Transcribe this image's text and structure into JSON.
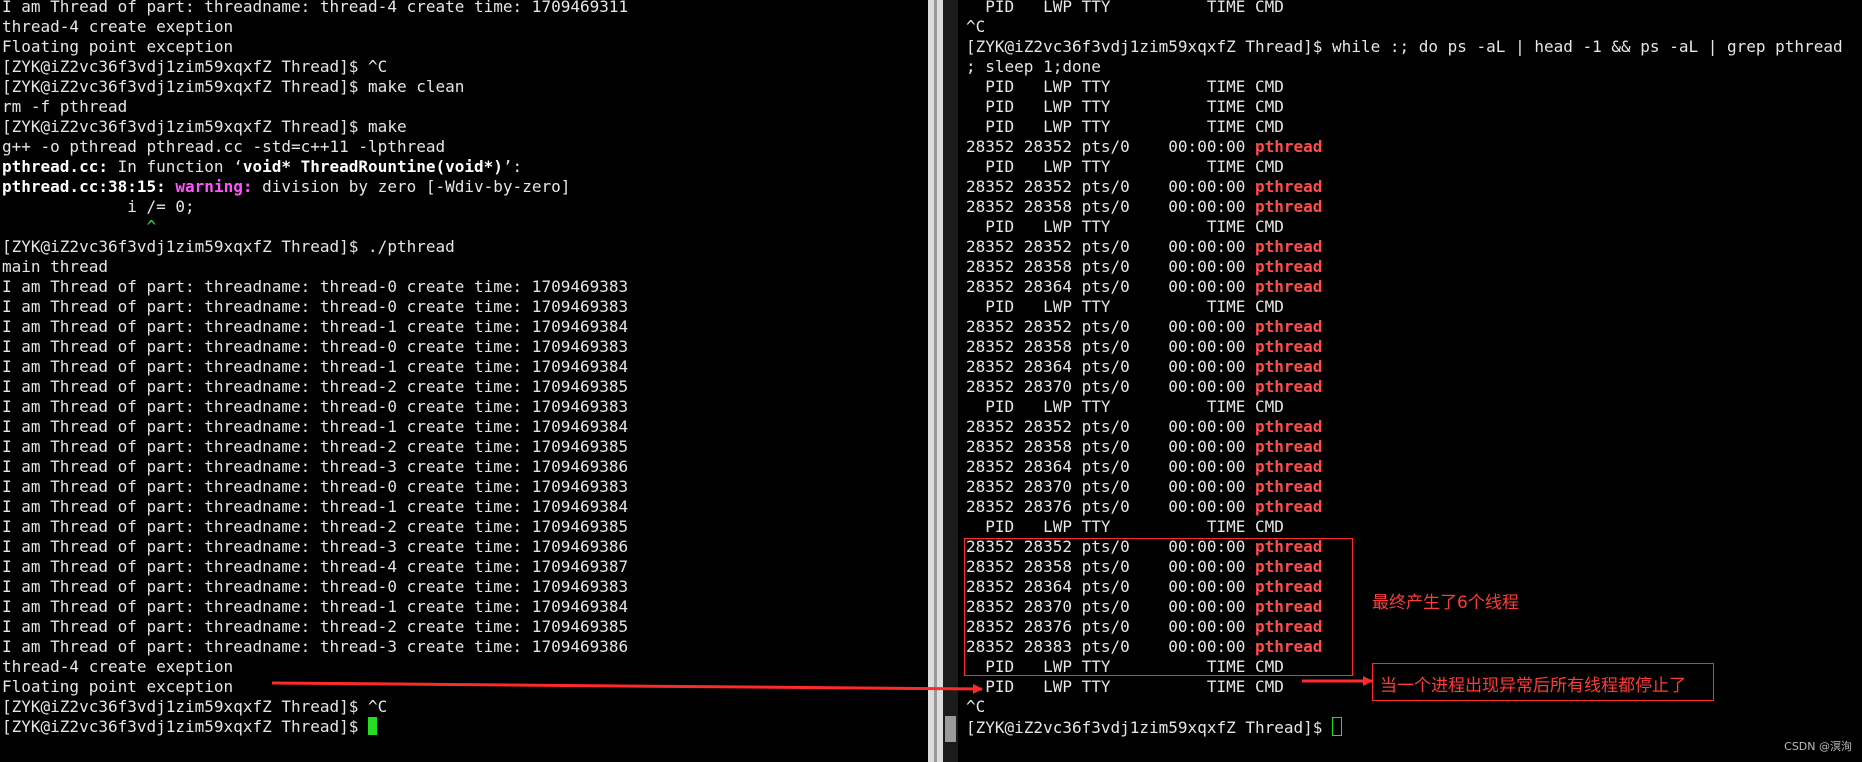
{
  "left_terminal": {
    "lines": [
      [
        {
          "t": "I am Thread of part: threadname: thread-4 create time: 1709469311"
        }
      ],
      [
        {
          "t": "thread-4 create exeption"
        }
      ],
      [
        {
          "t": "Floating point exception"
        }
      ],
      [
        {
          "t": "[ZYK@iZ2vc36f3vdj1zim59xqxfZ Thread]$ ^C"
        }
      ],
      [
        {
          "t": "[ZYK@iZ2vc36f3vdj1zim59xqxfZ Thread]$ make clean"
        }
      ],
      [
        {
          "t": "rm -f pthread"
        }
      ],
      [
        {
          "t": "[ZYK@iZ2vc36f3vdj1zim59xqxfZ Thread]$ make"
        }
      ],
      [
        {
          "t": "g++ -o pthread pthread.cc -std=c++11 -lpthread"
        }
      ],
      [
        {
          "t": "pthread.cc:",
          "s": "b"
        },
        {
          "t": " In function ‘"
        },
        {
          "t": "void* ThreadRountine(void*)",
          "s": "b"
        },
        {
          "t": "’:"
        }
      ],
      [
        {
          "t": "pthread.cc:38:15:",
          "s": "b"
        },
        {
          "t": " "
        },
        {
          "t": "warning:",
          "s": "m"
        },
        {
          "t": " division by zero [-Wdiv-by-zero]"
        }
      ],
      [
        {
          "t": "             i /= 0;"
        }
      ],
      [
        {
          "t": "               ^",
          "s": "g"
        }
      ],
      [
        {
          "t": "[ZYK@iZ2vc36f3vdj1zim59xqxfZ Thread]$ ./pthread"
        }
      ],
      [
        {
          "t": "main thread"
        }
      ],
      [
        {
          "t": "I am Thread of part: threadname: thread-0 create time: 1709469383"
        }
      ],
      [
        {
          "t": "I am Thread of part: threadname: thread-0 create time: 1709469383"
        }
      ],
      [
        {
          "t": "I am Thread of part: threadname: thread-1 create time: 1709469384"
        }
      ],
      [
        {
          "t": "I am Thread of part: threadname: thread-0 create time: 1709469383"
        }
      ],
      [
        {
          "t": "I am Thread of part: threadname: thread-1 create time: 1709469384"
        }
      ],
      [
        {
          "t": "I am Thread of part: threadname: thread-2 create time: 1709469385"
        }
      ],
      [
        {
          "t": "I am Thread of part: threadname: thread-0 create time: 1709469383"
        }
      ],
      [
        {
          "t": "I am Thread of part: threadname: thread-1 create time: 1709469384"
        }
      ],
      [
        {
          "t": "I am Thread of part: threadname: thread-2 create time: 1709469385"
        }
      ],
      [
        {
          "t": "I am Thread of part: threadname: thread-3 create time: 1709469386"
        }
      ],
      [
        {
          "t": "I am Thread of part: threadname: thread-0 create time: 1709469383"
        }
      ],
      [
        {
          "t": "I am Thread of part: threadname: thread-1 create time: 1709469384"
        }
      ],
      [
        {
          "t": "I am Thread of part: threadname: thread-2 create time: 1709469385"
        }
      ],
      [
        {
          "t": "I am Thread of part: threadname: thread-3 create time: 1709469386"
        }
      ],
      [
        {
          "t": "I am Thread of part: threadname: thread-4 create time: 1709469387"
        }
      ],
      [
        {
          "t": "I am Thread of part: threadname: thread-0 create time: 1709469383"
        }
      ],
      [
        {
          "t": "I am Thread of part: threadname: thread-1 create time: 1709469384"
        }
      ],
      [
        {
          "t": "I am Thread of part: threadname: thread-2 create time: 1709469385"
        }
      ],
      [
        {
          "t": "I am Thread of part: threadname: thread-3 create time: 1709469386"
        }
      ],
      [
        {
          "t": "thread-4 create exeption"
        }
      ],
      [
        {
          "t": "Floating point exception"
        }
      ],
      [
        {
          "t": "[ZYK@iZ2vc36f3vdj1zim59xqxfZ Thread]$ ^C"
        }
      ],
      [
        {
          "t": "[ZYK@iZ2vc36f3vdj1zim59xqxfZ Thread]$ "
        },
        {
          "cursor": "block"
        }
      ]
    ]
  },
  "right_terminal": {
    "lines": [
      [
        {
          "t": "  PID   LWP TTY          TIME CMD"
        }
      ],
      [
        {
          "t": "^C"
        }
      ],
      [
        {
          "t": "[ZYK@iZ2vc36f3vdj1zim59xqxfZ Thread]$ while :; do ps -aL | head -1 && ps -aL | grep pthread"
        }
      ],
      [
        {
          "t": "; sleep 1;done"
        }
      ],
      [
        {
          "t": "  PID   LWP TTY          TIME CMD"
        }
      ],
      [
        {
          "t": "  PID   LWP TTY          TIME CMD"
        }
      ],
      [
        {
          "t": "  PID   LWP TTY          TIME CMD"
        }
      ],
      [
        {
          "t": "28352 28352 pts/0    00:00:00 "
        },
        {
          "t": "pthread",
          "s": "r"
        }
      ],
      [
        {
          "t": "  PID   LWP TTY          TIME CMD"
        }
      ],
      [
        {
          "t": "28352 28352 pts/0    00:00:00 "
        },
        {
          "t": "pthread",
          "s": "r"
        }
      ],
      [
        {
          "t": "28352 28358 pts/0    00:00:00 "
        },
        {
          "t": "pthread",
          "s": "r"
        }
      ],
      [
        {
          "t": "  PID   LWP TTY          TIME CMD"
        }
      ],
      [
        {
          "t": "28352 28352 pts/0    00:00:00 "
        },
        {
          "t": "pthread",
          "s": "r"
        }
      ],
      [
        {
          "t": "28352 28358 pts/0    00:00:00 "
        },
        {
          "t": "pthread",
          "s": "r"
        }
      ],
      [
        {
          "t": "28352 28364 pts/0    00:00:00 "
        },
        {
          "t": "pthread",
          "s": "r"
        }
      ],
      [
        {
          "t": "  PID   LWP TTY          TIME CMD"
        }
      ],
      [
        {
          "t": "28352 28352 pts/0    00:00:00 "
        },
        {
          "t": "pthread",
          "s": "r"
        }
      ],
      [
        {
          "t": "28352 28358 pts/0    00:00:00 "
        },
        {
          "t": "pthread",
          "s": "r"
        }
      ],
      [
        {
          "t": "28352 28364 pts/0    00:00:00 "
        },
        {
          "t": "pthread",
          "s": "r"
        }
      ],
      [
        {
          "t": "28352 28370 pts/0    00:00:00 "
        },
        {
          "t": "pthread",
          "s": "r"
        }
      ],
      [
        {
          "t": "  PID   LWP TTY          TIME CMD"
        }
      ],
      [
        {
          "t": "28352 28352 pts/0    00:00:00 "
        },
        {
          "t": "pthread",
          "s": "r"
        }
      ],
      [
        {
          "t": "28352 28358 pts/0    00:00:00 "
        },
        {
          "t": "pthread",
          "s": "r"
        }
      ],
      [
        {
          "t": "28352 28364 pts/0    00:00:00 "
        },
        {
          "t": "pthread",
          "s": "r"
        }
      ],
      [
        {
          "t": "28352 28370 pts/0    00:00:00 "
        },
        {
          "t": "pthread",
          "s": "r"
        }
      ],
      [
        {
          "t": "28352 28376 pts/0    00:00:00 "
        },
        {
          "t": "pthread",
          "s": "r"
        }
      ],
      [
        {
          "t": "  PID   LWP TTY          TIME CMD"
        }
      ],
      [
        {
          "t": "28352 28352 pts/0    00:00:00 "
        },
        {
          "t": "pthread",
          "s": "r"
        }
      ],
      [
        {
          "t": "28352 28358 pts/0    00:00:00 "
        },
        {
          "t": "pthread",
          "s": "r"
        }
      ],
      [
        {
          "t": "28352 28364 pts/0    00:00:00 "
        },
        {
          "t": "pthread",
          "s": "r"
        }
      ],
      [
        {
          "t": "28352 28370 pts/0    00:00:00 "
        },
        {
          "t": "pthread",
          "s": "r"
        }
      ],
      [
        {
          "t": "28352 28376 pts/0    00:00:00 "
        },
        {
          "t": "pthread",
          "s": "r"
        }
      ],
      [
        {
          "t": "28352 28383 pts/0    00:00:00 "
        },
        {
          "t": "pthread",
          "s": "r"
        }
      ],
      [
        {
          "t": "  PID   LWP TTY          TIME CMD"
        }
      ],
      [
        {
          "t": "  PID   LWP TTY          TIME CMD"
        }
      ],
      [
        {
          "t": "^C"
        }
      ],
      [
        {
          "t": "[ZYK@iZ2vc36f3vdj1zim59xqxfZ Thread]$ "
        },
        {
          "cursor": "hollow"
        }
      ]
    ]
  },
  "annotations": {
    "thread_count_note": "最终产生了6个线程",
    "exception_note": "当一个进程出现异常后所有线程都停止了",
    "annotation_color": "#ff2a2a"
  },
  "watermark": "CSDN @溟洵"
}
